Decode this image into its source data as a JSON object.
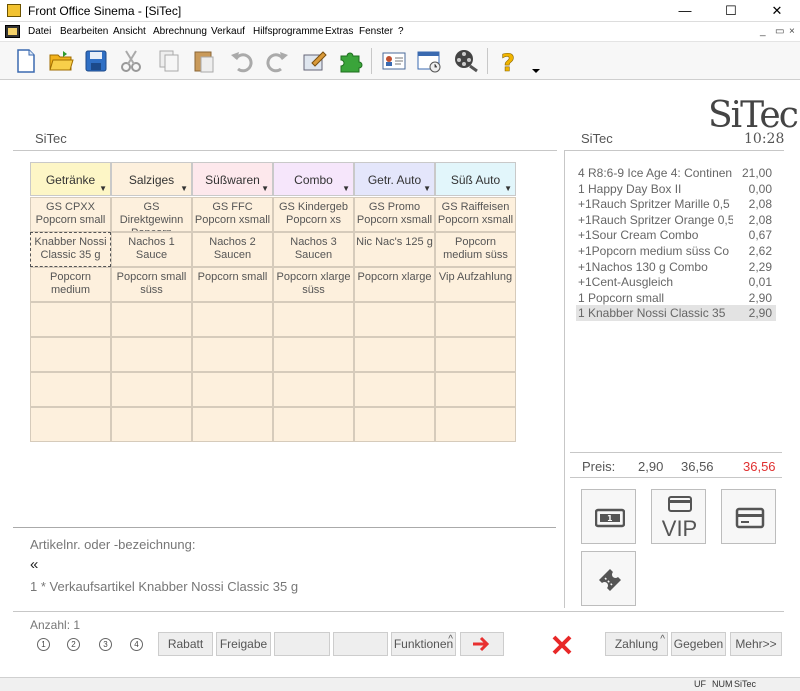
{
  "window": {
    "title": "Front Office Sinema - [SiTec]"
  },
  "menu": [
    "Datei",
    "Bearbeiten",
    "Ansicht",
    "Abrechnung",
    "Verkauf",
    "Hilfsprogramme",
    "Extras",
    "Fenster",
    "?"
  ],
  "logo": "SiTec",
  "left_title": "SiTec",
  "right_title": "SiTec",
  "clock": "10:28",
  "categories": [
    {
      "label": "Getränke",
      "color": "#fdf6c6"
    },
    {
      "label": "Salziges",
      "color": "#fdf0dd"
    },
    {
      "label": "Süßwaren",
      "color": "#fde8ec"
    },
    {
      "label": "Combo",
      "color": "#f6e6fb"
    },
    {
      "label": "Getr. Auto",
      "color": "#e4e6fb"
    },
    {
      "label": "Süß Auto",
      "color": "#e2f6fb"
    }
  ],
  "grid": [
    [
      "GS CPXX\nPopcorn small",
      "GS\nDirektgewinn\nPopcorn",
      "GS FFC\nPopcorn xsmall",
      "GS Kindergeb\nPopcorn xs",
      "GS Promo\nPopcorn xsmall",
      "GS Raiffeisen\nPopcorn xsmall"
    ],
    [
      "Knabber Nossi\nClassic 35 g",
      "Nachos 1\nSauce",
      "Nachos 2\nSaucen",
      "Nachos 3\nSaucen",
      "Nic Nac's 125 g",
      "Popcorn\nmedium süss"
    ],
    [
      "Popcorn\nmedium",
      "Popcorn small\nsüss",
      "Popcorn small",
      "Popcorn xlarge\nsüss",
      "Popcorn xlarge",
      "Vip Aufzahlung"
    ],
    [
      "",
      "",
      "",
      "",
      "",
      ""
    ],
    [
      "",
      "",
      "",
      "",
      "",
      ""
    ],
    [
      "",
      "",
      "",
      "",
      "",
      ""
    ],
    [
      "",
      "",
      "",
      "",
      "",
      ""
    ]
  ],
  "receipt": [
    {
      "text": "4  R8:6-9 Ice Age 4: Continen",
      "price": "21,00"
    },
    {
      "text": "1  Happy Day Box II",
      "price": "0,00"
    },
    {
      "text": "+1Rauch Spritzer Marille 0,5",
      "price": "2,08"
    },
    {
      "text": "+1Rauch Spritzer Orange 0,5",
      "price": "2,08"
    },
    {
      "text": "+1Sour Cream Combo",
      "price": "0,67"
    },
    {
      "text": "+1Popcorn medium süss Co",
      "price": "2,62"
    },
    {
      "text": "+1Nachos 130 g Combo",
      "price": "2,29"
    },
    {
      "text": "+1Cent-Ausgleich",
      "price": "0,01"
    },
    {
      "text": "1  Popcorn small",
      "price": "2,90"
    },
    {
      "text": "1  Knabber Nossi Classic 35",
      "price": "2,90"
    }
  ],
  "price": {
    "label": "Preis:",
    "unit": "2,90",
    "total": "36,56",
    "due": "36,56",
    "due_color": "#e03030"
  },
  "payment": {
    "vip_label": "VIP"
  },
  "input": {
    "label": "Artikelnr. oder -bezeichnung:",
    "value": "«",
    "last_line": "1 * Verkaufsartikel Knabber Nossi Classic 35 g"
  },
  "quantity": {
    "label": "Anzahl: 1",
    "options": [
      "1",
      "2",
      "3",
      "4"
    ]
  },
  "buttons": {
    "rabatt": "Rabatt",
    "freigabe": "Freigabe",
    "empty1": "",
    "empty2": "",
    "funktionen": "Funktionen",
    "zahlung": "Zahlung",
    "gegeben": "Gegeben",
    "mehr": "Mehr>>"
  },
  "status": {
    "uf": "UF",
    "num": "NUM",
    "app": "SiTec"
  }
}
